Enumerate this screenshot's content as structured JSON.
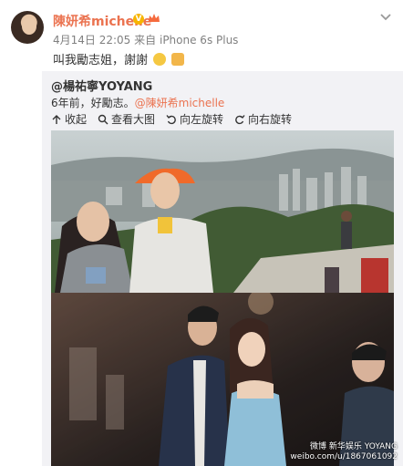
{
  "post": {
    "author": "陳妍希michelle",
    "meta_date": "4月14日 22:05",
    "meta_via": "来自",
    "meta_source": "iPhone 6s Plus",
    "text": "叫我勵志姐，謝謝",
    "icons": {
      "verified": "verified-icon",
      "crown": "crown-icon",
      "menu": "chevron-down-icon",
      "emoji1": "smile-emoji-icon",
      "emoji2": "hands-emoji-icon"
    }
  },
  "repost": {
    "author": "@楊祐寧YOYANG",
    "text_prefix": "6年前，好勵志。",
    "mention": "@陳妍希michelle",
    "actions": {
      "collapse": "收起",
      "view_large": "查看大图",
      "rotate_left": "向左旋转",
      "rotate_right": "向右旋转"
    }
  },
  "watermark": {
    "line1": "微博 新华娱乐 YOYANG",
    "line2": "weibo.com/u/1867061092"
  },
  "colors": {
    "accent": "#eb7350",
    "repost_bg": "#f2f2f5",
    "meta": "#808080"
  }
}
